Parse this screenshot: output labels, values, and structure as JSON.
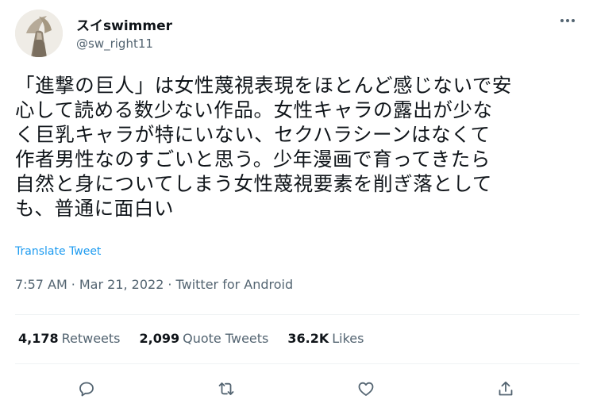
{
  "tweet": {
    "author": {
      "display_name": "スイswimmer",
      "handle": "@sw_right11",
      "avatar_icon": "winged-victory-statue-avatar"
    },
    "text_lines": [
      "「進撃の巨人」は女性蔑視表現をほとんど感じないで安",
      "心して読める数少ない作品。女性キャラの露出が少な",
      "く巨乳キャラが特にいない、セクハラシーンはなくて",
      "作者男性なのすごいと思う。少年漫画で育ってきたら",
      "自然と身についてしまう女性蔑視要素を削ぎ落として",
      "も、普通に面白い"
    ],
    "translate_label": "Translate Tweet",
    "time": "7:57 AM",
    "date": "Mar 21, 2022",
    "source": "Twitter for Android",
    "separator": "·",
    "stats": {
      "retweets": {
        "count": "4,178",
        "label": "Retweets"
      },
      "quote_tweets": {
        "count": "2,099",
        "label": "Quote Tweets"
      },
      "likes": {
        "count": "36.2K",
        "label": "Likes"
      }
    },
    "action_icons": [
      "reply-icon",
      "retweet-icon",
      "like-icon",
      "share-icon"
    ],
    "colors": {
      "text": "#0f1419",
      "secondary": "#536471",
      "link": "#1d9bf0",
      "divider": "#eff3f4"
    }
  }
}
